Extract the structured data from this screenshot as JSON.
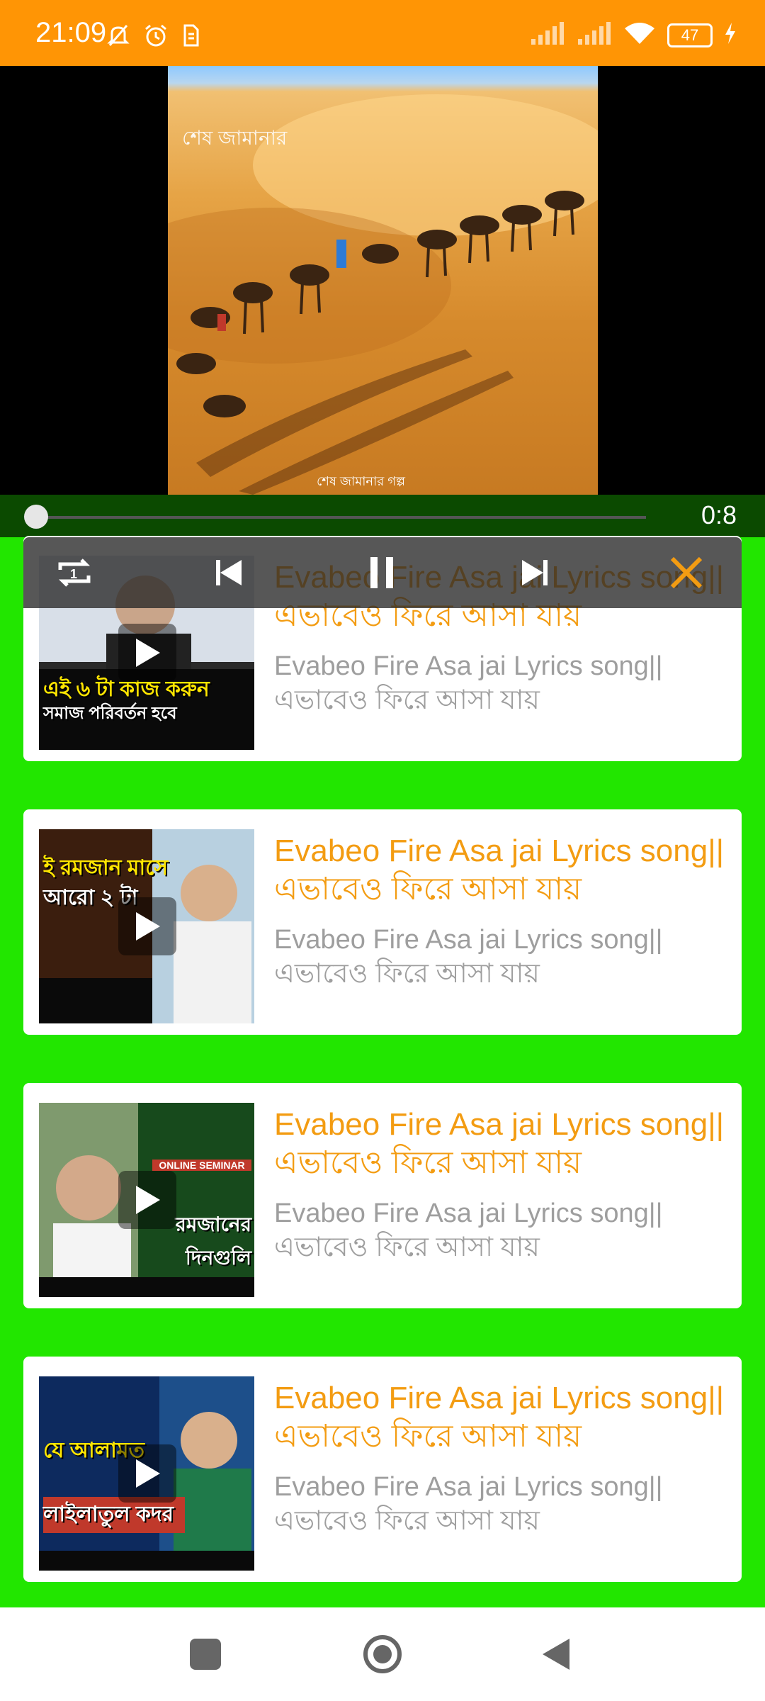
{
  "status_bar": {
    "time": "21:09",
    "battery": "47",
    "background": "#ff9505"
  },
  "player": {
    "watermark": "শেষ জামানার",
    "credit": "শেষ জামানার গল্প",
    "elapsed": "0:8",
    "progress": 0.0,
    "icons": [
      "repeat-one-icon",
      "skip-previous-icon",
      "pause-icon",
      "skip-next-icon",
      "close-icon"
    ]
  },
  "list": {
    "items": [
      {
        "title": "Evabeo Fire Asa jai Lyrics song|| এভাবেও ফিরে আসা যায়",
        "description": "Evabeo Fire Asa jai Lyrics song|| এভাবেও ফিরে আসা যায়",
        "thumb_caption_1": "এই ৬ টা কাজ করুন",
        "thumb_caption_2": "সমাজ পরিবর্তন হবে"
      },
      {
        "title": "Evabeo Fire Asa jai Lyrics song|| এভাবেও ফিরে আসা যায়",
        "description": "Evabeo Fire Asa jai Lyrics song|| এভাবেও ফিরে আসা যায়",
        "thumb_caption_1": "ই রমজান মাসে",
        "thumb_caption_2": "আরো ২ টা"
      },
      {
        "title": "Evabeo Fire Asa jai Lyrics song|| এভাবেও ফিরে আসা যায়",
        "description": "Evabeo Fire Asa jai Lyrics song|| এভাবেও ফিরে আসা যায়",
        "thumb_caption_1": "ONLINE SEMINAR",
        "thumb_caption_2": "রমজানের দিনগুলি"
      },
      {
        "title": "Evabeo Fire Asa jai Lyrics song|| এভাবেও ফিরে আসা যায়",
        "description": "Evabeo Fire Asa jai Lyrics song|| এভাবেও ফিরে আসা যায়",
        "thumb_caption_1": "যে আলামত",
        "thumb_caption_2": "লাইলাতুল কদর"
      }
    ]
  },
  "colors": {
    "background": "#22e600",
    "accent": "#f39c12",
    "muted_text": "#9e9e9e"
  }
}
